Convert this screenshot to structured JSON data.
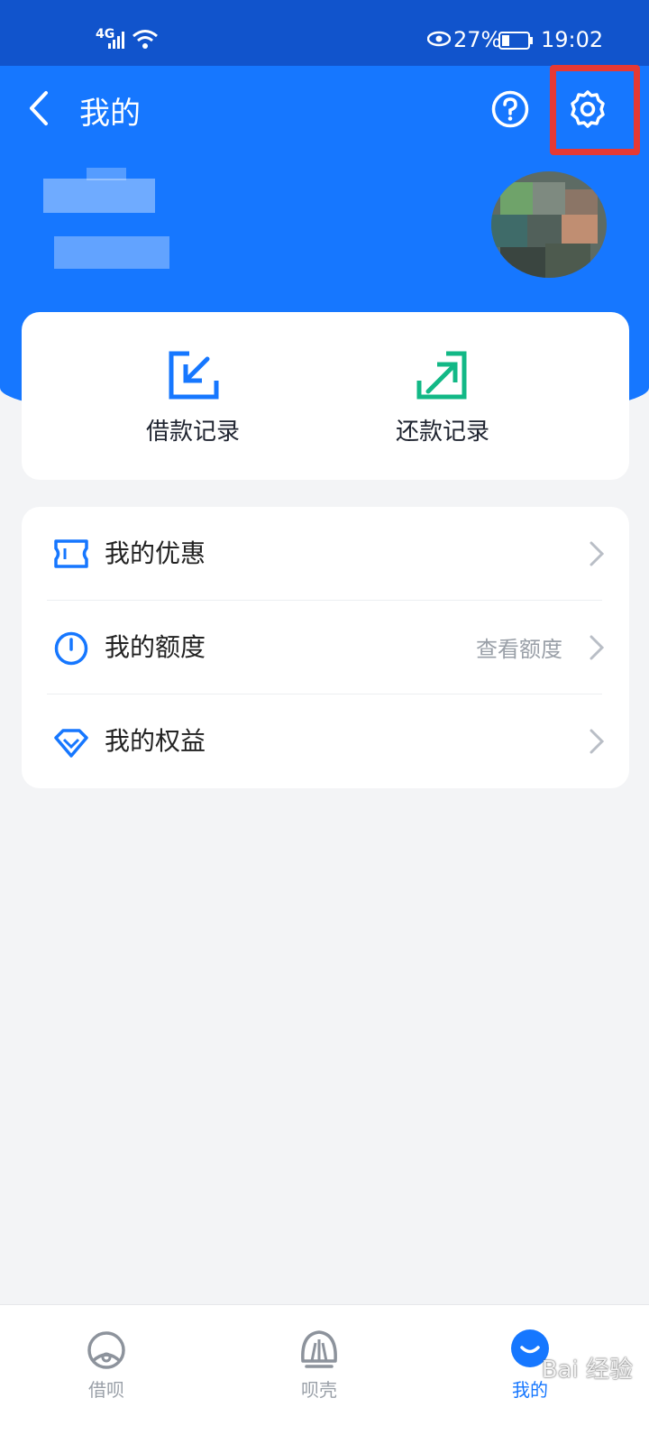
{
  "status_bar": {
    "network": "4G",
    "battery_pct": "27%",
    "time": "19:02"
  },
  "nav": {
    "title": "我的"
  },
  "quick_actions": [
    {
      "label": "借款记录",
      "icon": "loan-record-icon",
      "color": "#1677ff"
    },
    {
      "label": "还款记录",
      "icon": "repayment-record-icon",
      "color": "#12b886"
    }
  ],
  "menu": [
    {
      "label": "我的优惠",
      "icon": "coupon-icon",
      "sub": ""
    },
    {
      "label": "我的额度",
      "icon": "quota-icon",
      "sub": "查看额度"
    },
    {
      "label": "我的权益",
      "icon": "diamond-icon",
      "sub": ""
    }
  ],
  "tabs": [
    {
      "label": "借呗",
      "active": false
    },
    {
      "label": "呗壳",
      "active": false
    },
    {
      "label": "我的",
      "active": true
    }
  ],
  "watermark": "Bai 经验",
  "colors": {
    "primary": "#1677ff",
    "status_bar": "#1154cc",
    "highlight": "#e53935",
    "green": "#12b886"
  }
}
